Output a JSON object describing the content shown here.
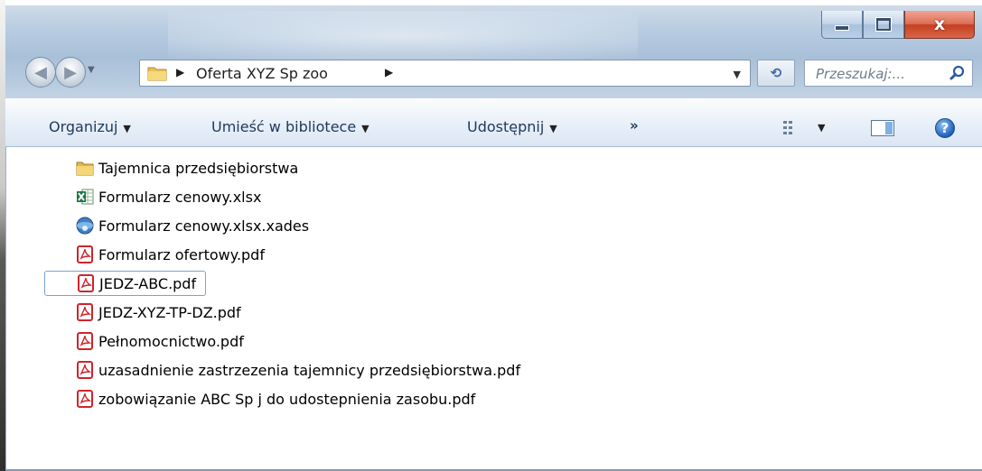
{
  "window": {
    "buttons": {
      "minimize": "—",
      "maximize": "□",
      "close": "x"
    }
  },
  "address_bar": {
    "path": "Oferta XYZ Sp zoo",
    "refresh_glyph": "⟲"
  },
  "search": {
    "placeholder": "Przeszukaj:..."
  },
  "toolbar": {
    "organize": "Organizuj",
    "include_in_library": "Umieść w bibliotece",
    "share": "Udostępnij",
    "more": "»"
  },
  "files": [
    {
      "name": "Tajemnica przedsiębiorstwa",
      "icon": "folder-icon"
    },
    {
      "name": "Formularz cenowy.xlsx",
      "icon": "excel-icon"
    },
    {
      "name": "Formularz cenowy.xlsx.xades",
      "icon": "signature-file-icon"
    },
    {
      "name": "Formularz ofertowy.pdf",
      "icon": "pdf-icon"
    },
    {
      "name": "JEDZ-ABC.pdf",
      "icon": "pdf-icon",
      "selected": true
    },
    {
      "name": "JEDZ-XYZ-TP-DZ.pdf",
      "icon": "pdf-icon"
    },
    {
      "name": "Pełnomocnictwo.pdf",
      "icon": "pdf-icon"
    },
    {
      "name": "uzasadnienie zastrzezenia tajemnicy przedsiębiorstwa.pdf",
      "icon": "pdf-icon"
    },
    {
      "name": "zobowiązanie ABC Sp j do udostepnienia zasobu.pdf",
      "icon": "pdf-icon"
    }
  ],
  "colors": {
    "toolbar_text": "#1e395b",
    "selection_border": "#7da2ce",
    "close_button": "#c4401f",
    "pdf_red": "#d0242b"
  }
}
